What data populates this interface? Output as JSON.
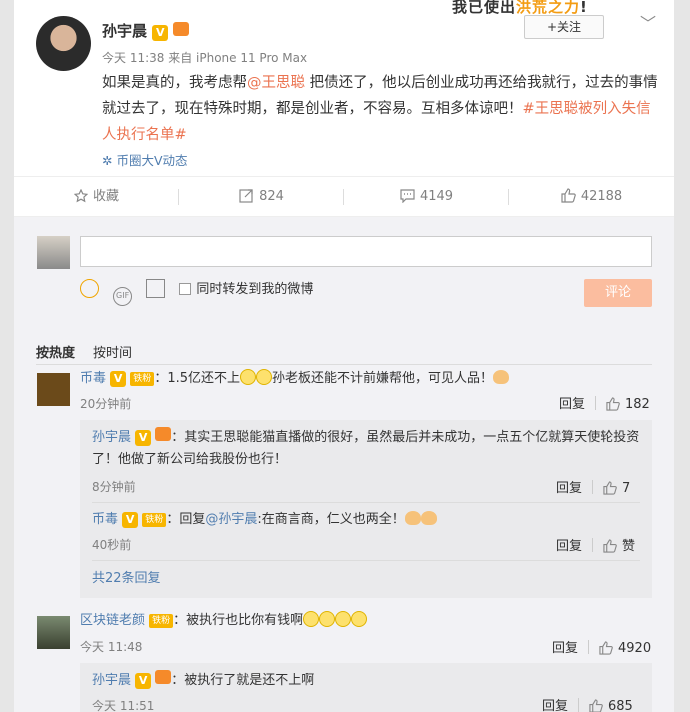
{
  "post": {
    "banner": {
      "pre": "我已使出",
      "hl": "洪荒之力",
      "post": "!"
    },
    "username": "孙宇晨",
    "follow_label": "+关注",
    "meta": "今天 11:38 来自 iPhone 11 Pro Max",
    "text_pre": "如果是真的，我考虑帮",
    "mention": "@王思聪",
    "text_mid": " 把债还了，他以后创业成功再还给我就行，过去的事情就过去了，现在特殊时期，都是创业者，不容易。互相多体谅吧！",
    "hashtag": "#王思聪被列入失信人执行名单#",
    "source_tag": "币圈大V动态"
  },
  "actions": {
    "collect": "收藏",
    "forward": "824",
    "comment": "4149",
    "like": "42188"
  },
  "composer": {
    "sync_label": "同时转发到我的微博",
    "submit_label": "评论"
  },
  "sort": {
    "hot": "按热度",
    "time": "按时间"
  },
  "comments": [
    {
      "user": "币毒",
      "tag": "铁粉",
      "text_a": "：1.5亿还不上",
      "text_b": "孙老板还能不计前嫌帮他，可见人品！",
      "time": "20分钟前",
      "reply": "回复",
      "likes": "182"
    },
    {
      "user": "区块链老颜",
      "tag": "铁粉",
      "text_a": "：被执行也比你有钱啊",
      "time": "今天 11:48",
      "reply": "回复",
      "likes": "4920"
    }
  ],
  "replies": [
    {
      "user": "孙宇晨",
      "text": "：其实王思聪能猫直播做的很好，虽然最后并未成功，一点五个亿就算天使轮投资了！他做了新公司给我股份也行！",
      "time": "8分钟前",
      "reply": "回复",
      "likes": "7"
    },
    {
      "user": "币毒",
      "tag": "铁粉",
      "text_pre": "：回复",
      "mention": "@孙宇晨",
      "text": ":在商言商，仁义也两全！",
      "time": "40秒前",
      "reply": "回复",
      "likes": "赞"
    },
    {
      "user": "孙宇晨",
      "text": "：被执行了就是还不上啊",
      "time": "今天 11:51",
      "reply": "回复",
      "likes": "685"
    }
  ],
  "more_replies": "共22条回复",
  "colors": {
    "accent": "#eb7350",
    "link": "#507daf",
    "submit": "#fbbd9f"
  }
}
